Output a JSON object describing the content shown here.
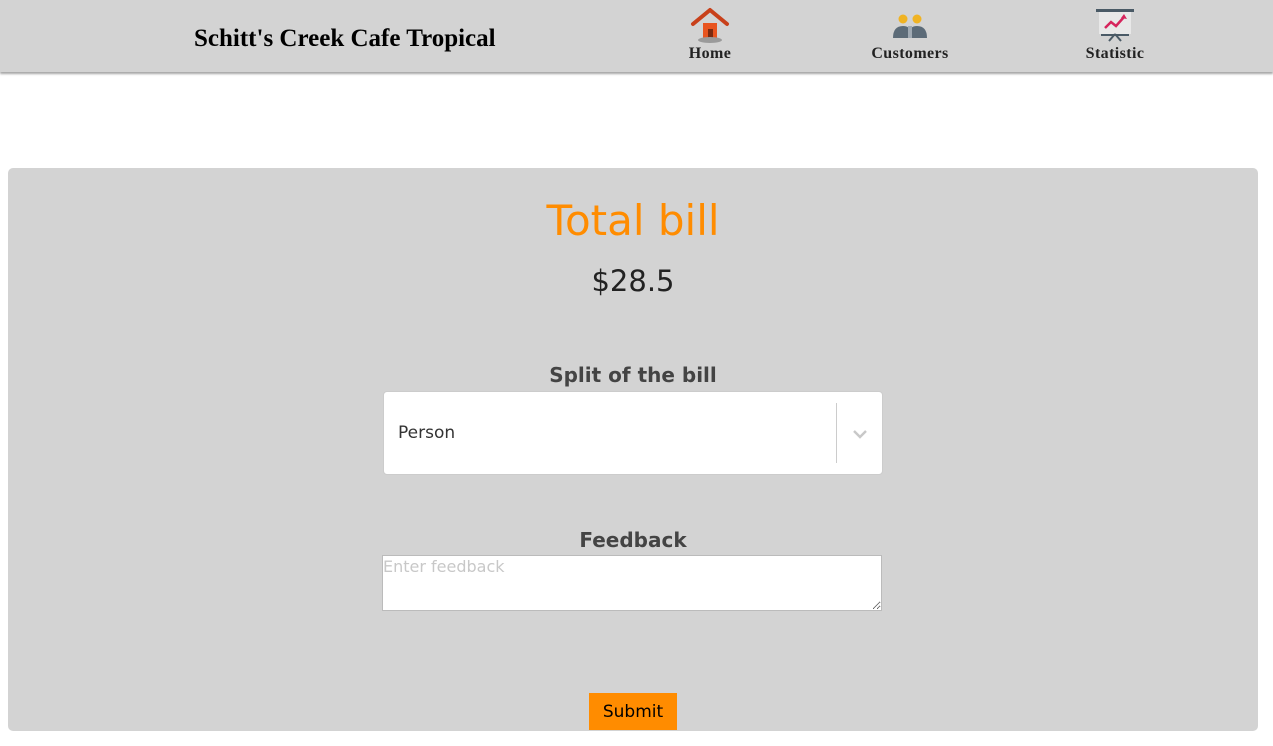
{
  "header": {
    "brand": "Schitt's Creek Cafe Tropical",
    "nav": [
      {
        "label": "Home",
        "icon": "home-icon"
      },
      {
        "label": "Customers",
        "icon": "customers-icon"
      },
      {
        "label": "Statistic",
        "icon": "statistic-icon"
      }
    ]
  },
  "bill": {
    "title": "Total bill",
    "amount": "$28.5"
  },
  "split": {
    "label": "Split of the bill",
    "selected": "Person"
  },
  "feedback": {
    "label": "Feedback",
    "placeholder": "Enter feedback",
    "value": ""
  },
  "submit": {
    "label": "Submit"
  },
  "colors": {
    "accent": "#ff8c00",
    "panel": "#d3d3d3",
    "header": "#d3d3d3"
  }
}
